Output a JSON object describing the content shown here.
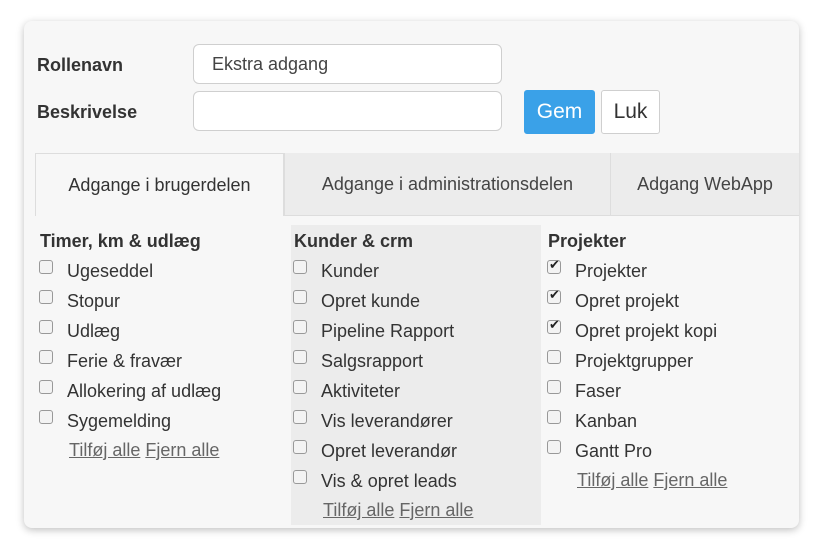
{
  "form": {
    "role_name_label": "Rollenavn",
    "role_name_value": "Ekstra adgang",
    "description_label": "Beskrivelse",
    "description_value": "",
    "save_label": "Gem",
    "close_label": "Luk"
  },
  "tabs": [
    {
      "label": "Adgange i brugerdelen",
      "active": true
    },
    {
      "label": "Adgange i administrationsdelen",
      "active": false
    },
    {
      "label": "Adgang WebApp",
      "active": false
    }
  ],
  "groups": [
    {
      "title": "Timer, km & udlæg",
      "items": [
        {
          "label": "Ugeseddel",
          "checked": false
        },
        {
          "label": "Stopur",
          "checked": false
        },
        {
          "label": "Udlæg",
          "checked": false
        },
        {
          "label": "Ferie & fravær",
          "checked": false
        },
        {
          "label": "Allokering af udlæg",
          "checked": false
        },
        {
          "label": "Sygemelding",
          "checked": false
        }
      ],
      "add_all": "Tilføj alle",
      "remove_all": "Fjern alle"
    },
    {
      "title": "Kunder & crm",
      "items": [
        {
          "label": "Kunder",
          "checked": false
        },
        {
          "label": "Opret kunde",
          "checked": false
        },
        {
          "label": "Pipeline Rapport",
          "checked": false
        },
        {
          "label": "Salgsrapport",
          "checked": false
        },
        {
          "label": "Aktiviteter",
          "checked": false
        },
        {
          "label": "Vis leverandører",
          "checked": false
        },
        {
          "label": "Opret leverandør",
          "checked": false
        },
        {
          "label": "Vis & opret leads",
          "checked": false
        }
      ],
      "add_all": "Tilføj alle",
      "remove_all": "Fjern alle"
    },
    {
      "title": "Projekter",
      "items": [
        {
          "label": "Projekter",
          "checked": true
        },
        {
          "label": "Opret projekt",
          "checked": true
        },
        {
          "label": "Opret projekt kopi",
          "checked": true
        },
        {
          "label": "Projektgrupper",
          "checked": false
        },
        {
          "label": "Faser",
          "checked": false
        },
        {
          "label": "Kanban",
          "checked": false
        },
        {
          "label": "Gantt Pro",
          "checked": false
        }
      ],
      "add_all": "Tilføj alle",
      "remove_all": "Fjern alle"
    }
  ]
}
